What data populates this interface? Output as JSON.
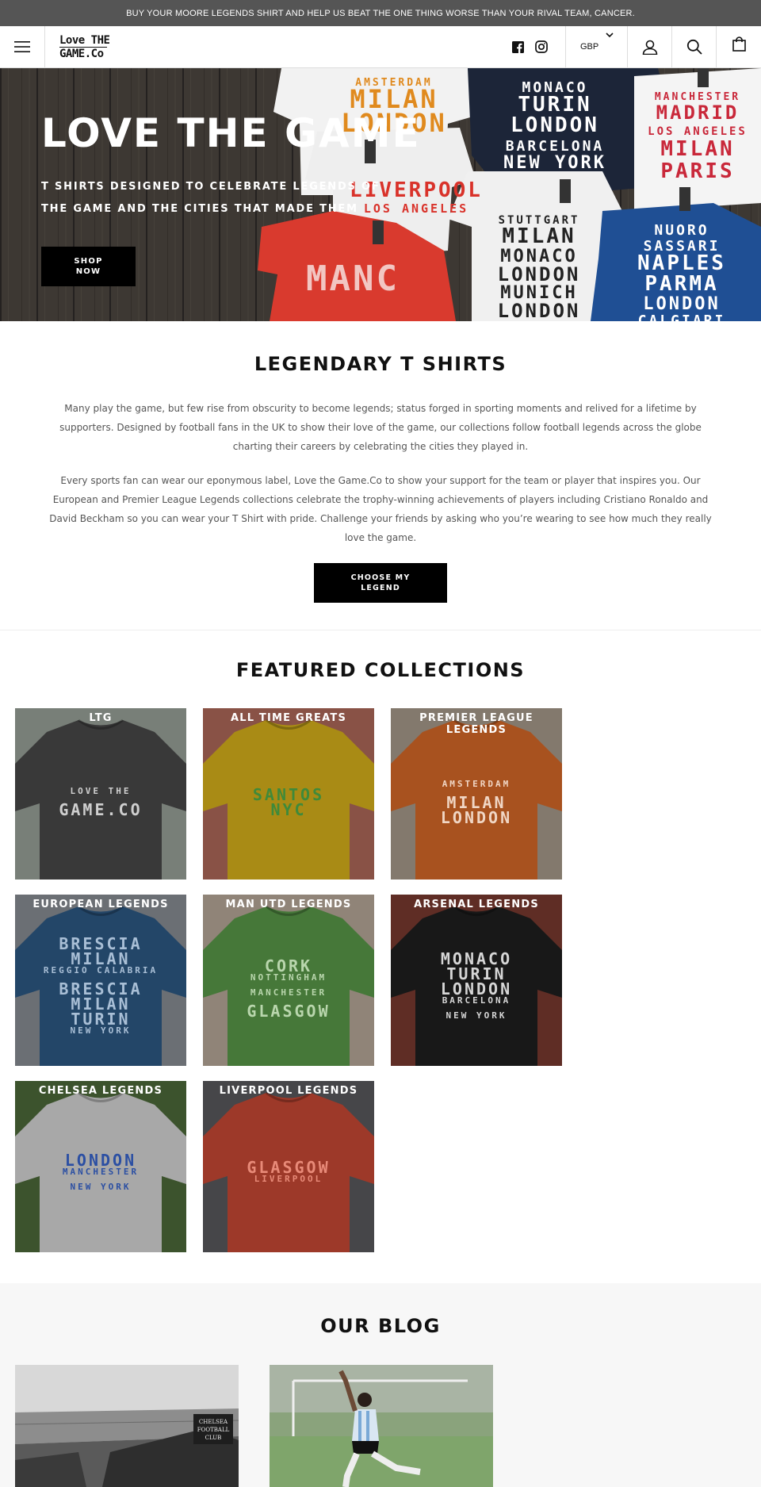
{
  "announcement": "BUY YOUR MOORE LEGENDS SHIRT AND HELP US BEAT THE ONE THING WORSE THAN YOUR RIVAL TEAM, CANCER.",
  "header": {
    "logo_line1": "Love THE",
    "logo_line2": "GAME.Co",
    "currency": "GBP",
    "icons": [
      "menu-icon",
      "facebook-icon",
      "instagram-icon",
      "chevron-down-icon",
      "account-icon",
      "search-icon",
      "bag-icon"
    ]
  },
  "hero": {
    "title": "LOVE THE GAME",
    "subtitle": "T SHIRTS DESIGNED TO CELEBRATE LEGENDS OF THE GAME AND THE CITIES THAT MADE THEM",
    "button": "SHOP NOW",
    "shirts": [
      {
        "lines": [
          "AMSTERDAM",
          "MILAN",
          "LONDON"
        ]
      },
      {
        "lines": [
          "MONACO",
          "TURIN",
          "LONDON",
          "BARCELONA",
          "NEW YORK"
        ]
      },
      {
        "lines": [
          "MANCHESTER",
          "MADRID",
          "LOS ANGELES",
          "MILAN",
          "PARIS"
        ]
      },
      {
        "lines": [
          "LIVERPOOL",
          "LOS ANGELES"
        ]
      },
      {
        "lines": [
          "STUTTGART",
          "MILAN",
          "MONACO",
          "LONDON",
          "MUNICH",
          "LONDON"
        ]
      },
      {
        "lines": [
          "NUORO",
          "SASSARI",
          "NAPLES",
          "PARMA",
          "LONDON",
          "CALGIARI"
        ]
      },
      {
        "lines": [
          "MANC"
        ]
      }
    ]
  },
  "intro": {
    "title": "LEGENDARY T SHIRTS",
    "paragraph1": "Many play the game, but few rise from obscurity to become legends; status forged in sporting moments and relived for a lifetime by supporters. Designed by football fans in the UK to show their love of the game, our collections follow football legends across the globe charting their careers by celebrating the cities they played in.",
    "paragraph2": "Every sports fan can wear our eponymous label, Love the Game.Co to show your support for the team or player that inspires you. Our European and Premier League Legends collections celebrate the trophy-winning achievements of players including Cristiano Ronaldo and David Beckham so you can wear your T Shirt with pride. Challenge your friends by asking who you’re wearing to see how much they really love the game.",
    "button": "CHOOSE MY LEGEND"
  },
  "featured": {
    "title": "FEATURED COLLECTIONS",
    "collections": [
      {
        "label": "LTG",
        "color": "#4a4a4a",
        "bg": "#9aa39a",
        "print": [
          "LOVE THE",
          "GAME.CO"
        ],
        "print_color": "#cfcfcf"
      },
      {
        "label": "ALL TIME GREATS",
        "color": "#d9b31c",
        "bg": "#b06a5a",
        "print": [
          "SANTOS",
          "NYC"
        ],
        "print_color": "#3f8a3a"
      },
      {
        "label": "PREMIER LEAGUE LEGENDS",
        "color": "#d86a28",
        "bg": "#a89b8c",
        "print": [
          "AMSTERDAM",
          "MILAN",
          "LONDON"
        ],
        "print_color": "#f0d6c4"
      },
      {
        "label": "EUROPEAN LEGENDS",
        "color": "#2e5a86",
        "bg": "#8a8f95",
        "print": [
          "BRESCIA",
          "MILAN",
          "REGGIO CALABRIA",
          "BRESCIA",
          "MILAN",
          "TURIN",
          "NEW YORK"
        ],
        "print_color": "#a9bfd6"
      },
      {
        "label": "MAN UTD LEGENDS",
        "color": "#5a9a4a",
        "bg": "#b9a99a",
        "print": [
          "CORK",
          "NOTTINGHAM",
          "MANCHESTER",
          "GLASGOW"
        ],
        "print_color": "#b9d6ad"
      },
      {
        "label": "ARSENAL LEGENDS",
        "color": "#1f1f1f",
        "bg": "#7a3a30",
        "print": [
          "MONACO",
          "TURIN",
          "LONDON",
          "BARCELONA",
          "NEW YORK"
        ],
        "print_color": "#d6d6d6"
      },
      {
        "label": "CHELSEA LEGENDS",
        "color": "#d8d8d8",
        "bg": "#4d6b3a",
        "print": [
          "LONDON",
          "MANCHESTER",
          "NEW YORK"
        ],
        "print_color": "#2b4fa3"
      },
      {
        "label": "LIVERPOOL LEGENDS",
        "color": "#c94a35",
        "bg": "#5a5a5e",
        "print": [
          "GLASGOW",
          "LIVERPOOL"
        ],
        "print_color": "#e88a78"
      }
    ]
  },
  "blog": {
    "title": "OUR BLOG",
    "stadium_sign": [
      "CHELSEA",
      "FOOTBALL",
      "CLUB"
    ]
  }
}
